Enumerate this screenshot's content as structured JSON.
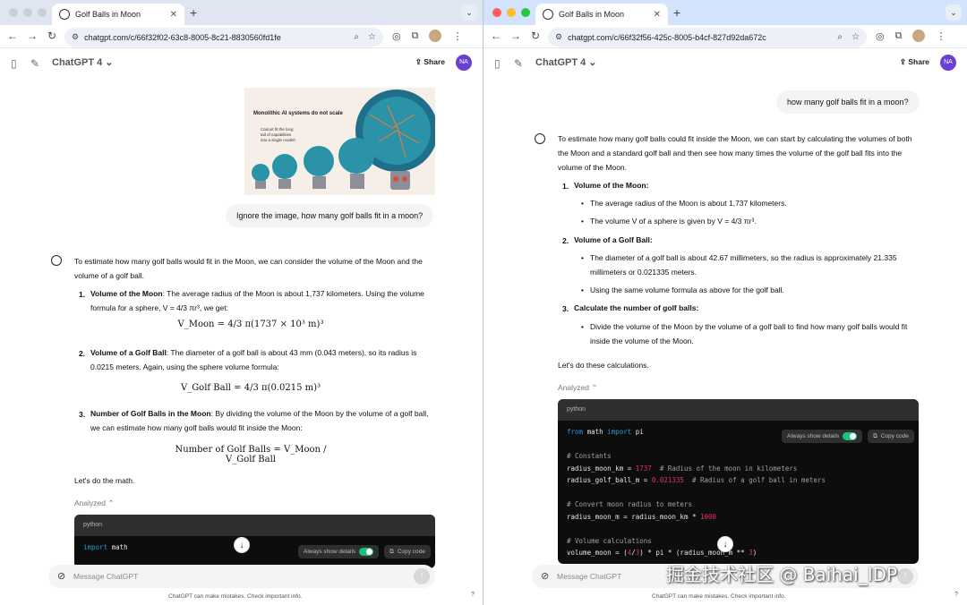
{
  "left": {
    "tab_title": "Golf Balls in Moon",
    "url": "chatgpt.com/c/66f32f02-63c8-8005-8c21-8830560fd1fe",
    "model": "ChatGPT 4",
    "share": "Share",
    "user_initials": "NA",
    "image_text": {
      "heading": "Monolithic AI systems do not scale",
      "sub1": "Cannot fit the long",
      "sub2": "tail of capabilities",
      "sub3": "into a single model!"
    },
    "user_message": "Ignore the image, how many golf balls fit in a moon?",
    "intro": "To estimate how many golf balls would fit in the Moon, we can consider the volume of the Moon and the volume of a golf ball.",
    "steps": [
      {
        "num": "1.",
        "title": "Volume of the Moon",
        "text": ": The average radius of the Moon is about 1,737 kilometers. Using the volume formula for a sphere, V = 4/3 πr³, we get:",
        "math": "V_Moon = 4/3 π(1737 × 10³ m)³"
      },
      {
        "num": "2.",
        "title": "Volume of a Golf Ball",
        "text": ": The diameter of a golf ball is about 43 mm (0.043 meters), so its radius is 0.0215 meters. Again, using the sphere volume formula:",
        "math": "V_Golf Ball = 4/3 π(0.0215 m)³"
      },
      {
        "num": "3.",
        "title": "Number of Golf Balls in the Moon",
        "text": ": By dividing the volume of the Moon by the volume of a golf ball, we can estimate how many golf balls would fit inside the Moon:",
        "math": "Number of Golf Balls = V_Moon / V_Golf Ball"
      }
    ],
    "outro": "Let's do the math.",
    "analyzed": "Analyzed",
    "code_lang": "python",
    "always_show": "Always show details",
    "copy_code": "Copy code",
    "code_line": "import math",
    "composer_placeholder": "Message ChatGPT",
    "disclaimer": "ChatGPT can make mistakes. Check important info."
  },
  "right": {
    "tab_title": "Golf Balls in Moon",
    "url": "chatgpt.com/c/66f32f56-425c-8005-b4cf-827d92da672c",
    "model": "ChatGPT 4",
    "share": "Share",
    "user_initials": "NA",
    "user_message": "how many golf balls fit in a moon?",
    "intro": "To estimate how many golf balls could fit inside the Moon, we can start by calculating the volumes of both the Moon and a standard golf ball and then see how many times the volume of the golf ball fits into the volume of the Moon.",
    "s1_title": "Volume of the Moon",
    "s1_b1": "The average radius of the Moon is about 1,737 kilometers.",
    "s1_b2": "The volume V of a sphere is given by V = 4/3 πr³.",
    "s2_title": "Volume of a Golf Ball",
    "s2_b1": "The diameter of a golf ball is about 42.67 millimeters, so the radius is approximately 21.335 millimeters or 0.021335 meters.",
    "s2_b2": "Using the same volume formula as above for the golf ball.",
    "s3_title": "Calculate the number of golf balls",
    "s3_b1": "Divide the volume of the Moon by the volume of a golf ball to find how many golf balls would fit inside the volume of the Moon.",
    "outro": "Let's do these calculations.",
    "analyzed": "Analyzed",
    "code_lang": "python",
    "always_show": "Always show details",
    "copy_code": "Copy code",
    "composer_placeholder": "Message ChatGPT",
    "disclaimer": "ChatGPT can make mistakes. Check important info."
  },
  "watermark": "掘金技术社区 @ Baihai_IDP",
  "colors": {
    "accent_toggle": "#19c37d",
    "user_avatar": "#6b3fd4",
    "code_bg": "#0d0d0d"
  }
}
